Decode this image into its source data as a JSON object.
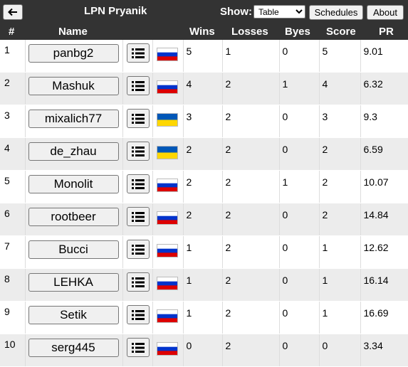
{
  "header": {
    "title": "LPN Pryanik",
    "show_label": "Show:",
    "show_options": [
      "Table"
    ],
    "show_selected": "Table",
    "schedules_label": "Schedules",
    "about_label": "About",
    "back_icon": "arrow-left-icon"
  },
  "columns": {
    "rank": "#",
    "name": "Name",
    "wins": "Wins",
    "losses": "Losses",
    "byes": "Byes",
    "score": "Score",
    "pr": "PR"
  },
  "flag_colors": {
    "ru": [
      "#ffffff",
      "#0033cc",
      "#dd0000"
    ],
    "ua": [
      "#0057b7",
      "#ffd700"
    ]
  },
  "rows": [
    {
      "rank": "1",
      "name": "panbg2",
      "flag": "ru",
      "wins": "5",
      "losses": "1",
      "byes": "0",
      "score": "5",
      "pr": "9.01"
    },
    {
      "rank": "2",
      "name": "Mashuk",
      "flag": "ru",
      "wins": "4",
      "losses": "2",
      "byes": "1",
      "score": "4",
      "pr": "6.32"
    },
    {
      "rank": "3",
      "name": "mixalich77",
      "flag": "ua",
      "wins": "3",
      "losses": "2",
      "byes": "0",
      "score": "3",
      "pr": "9.3"
    },
    {
      "rank": "4",
      "name": "de_zhau",
      "flag": "ua",
      "wins": "2",
      "losses": "2",
      "byes": "0",
      "score": "2",
      "pr": "6.59"
    },
    {
      "rank": "5",
      "name": "Monolit",
      "flag": "ru",
      "wins": "2",
      "losses": "2",
      "byes": "1",
      "score": "2",
      "pr": "10.07"
    },
    {
      "rank": "6",
      "name": "rootbeer",
      "flag": "ru",
      "wins": "2",
      "losses": "2",
      "byes": "0",
      "score": "2",
      "pr": "14.84"
    },
    {
      "rank": "7",
      "name": "Bucci",
      "flag": "ru",
      "wins": "1",
      "losses": "2",
      "byes": "0",
      "score": "1",
      "pr": "12.62"
    },
    {
      "rank": "8",
      "name": "LEHKA",
      "flag": "ru",
      "wins": "1",
      "losses": "2",
      "byes": "0",
      "score": "1",
      "pr": "16.14"
    },
    {
      "rank": "9",
      "name": "Setik",
      "flag": "ru",
      "wins": "1",
      "losses": "2",
      "byes": "0",
      "score": "1",
      "pr": "16.69"
    },
    {
      "rank": "10",
      "name": "serg445",
      "flag": "ru",
      "wins": "0",
      "losses": "2",
      "byes": "0",
      "score": "0",
      "pr": "3.34"
    }
  ]
}
